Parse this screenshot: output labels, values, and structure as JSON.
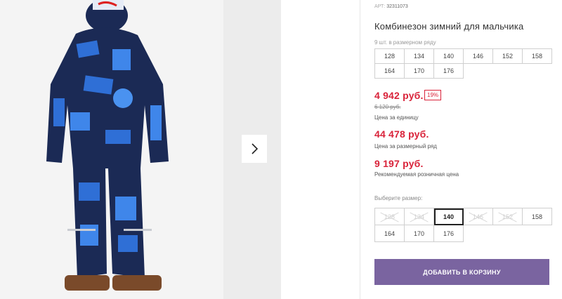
{
  "product": {
    "sku_label": "АРТ:",
    "sku_value": "32311073",
    "title": "Комбинезон зимний для мальчика",
    "qty_note": "9 шт. в размерном ряду",
    "size_row": [
      "128",
      "134",
      "140",
      "146",
      "152",
      "158",
      "164",
      "170",
      "176"
    ]
  },
  "pricing": {
    "unit_price": "4 942 руб.",
    "discount_badge": "19%",
    "old_price": "6 120 руб.",
    "unit_caption": "Цена за единицу",
    "row_price": "44 478 руб.",
    "row_caption": "Цена за размерный ряд",
    "rrp_price": "9 197 руб.",
    "rrp_caption": "Рекомендуемая розничная цена"
  },
  "size_picker": {
    "label": "Выберите размер:",
    "options": [
      {
        "label": "128",
        "state": "disabled"
      },
      {
        "label": "134",
        "state": "disabled"
      },
      {
        "label": "140",
        "state": "selected"
      },
      {
        "label": "146",
        "state": "disabled"
      },
      {
        "label": "152",
        "state": "disabled"
      },
      {
        "label": "158",
        "state": "available"
      },
      {
        "label": "164",
        "state": "available"
      },
      {
        "label": "170",
        "state": "available"
      },
      {
        "label": "176",
        "state": "available"
      }
    ]
  },
  "actions": {
    "add_to_cart": "ДОБАВИТЬ В КОРЗИНУ"
  },
  "gallery": {
    "next_icon": "chevron-right-icon"
  },
  "colors": {
    "accent": "#7a64a0",
    "price_red": "#d9233a",
    "jacket_navy": "#1b2a55",
    "jacket_blue": "#2f6fd6"
  }
}
